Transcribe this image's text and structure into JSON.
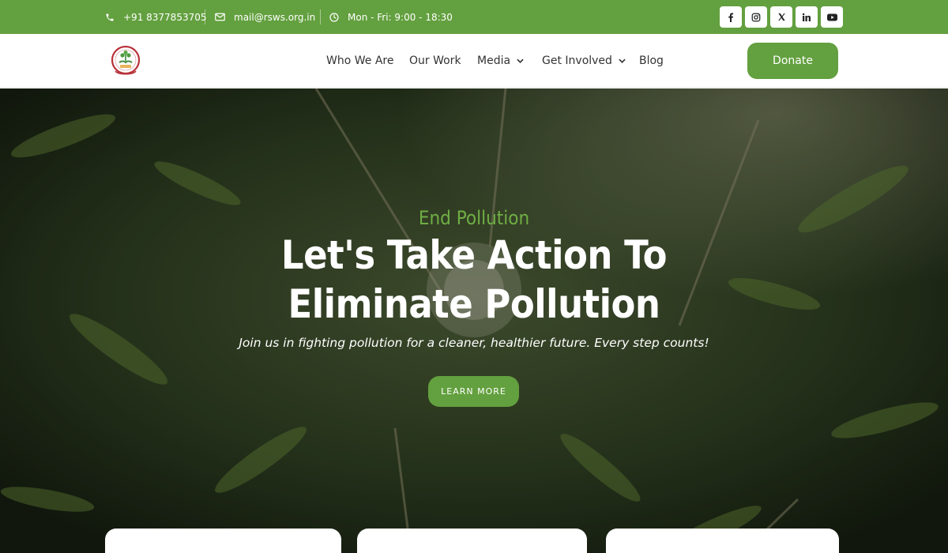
{
  "topbar": {
    "phone": "+91 8377853705",
    "email": "mail@rsws.org.in",
    "hours": "Mon - Fri: 9:00 - 18:30",
    "social_icons": [
      "facebook-icon",
      "instagram-icon",
      "x-icon",
      "linkedin-icon",
      "youtube-icon"
    ]
  },
  "header": {
    "nav": {
      "who_we_are": "Who We Are",
      "our_work": "Our Work",
      "media": "Media",
      "get_involved": "Get Involved",
      "blog": "Blog"
    },
    "donate_label": "Donate"
  },
  "hero": {
    "eyebrow": "End Pollution",
    "headline": "Let's Take Action To Eliminate Pollution",
    "subtitle": "Join us in fighting pollution for a cleaner, healthier future. Every step counts!",
    "cta_label": "LEARN MORE"
  },
  "colors": {
    "brand_green": "#63a03f",
    "eyebrow_green": "#6fae44"
  }
}
